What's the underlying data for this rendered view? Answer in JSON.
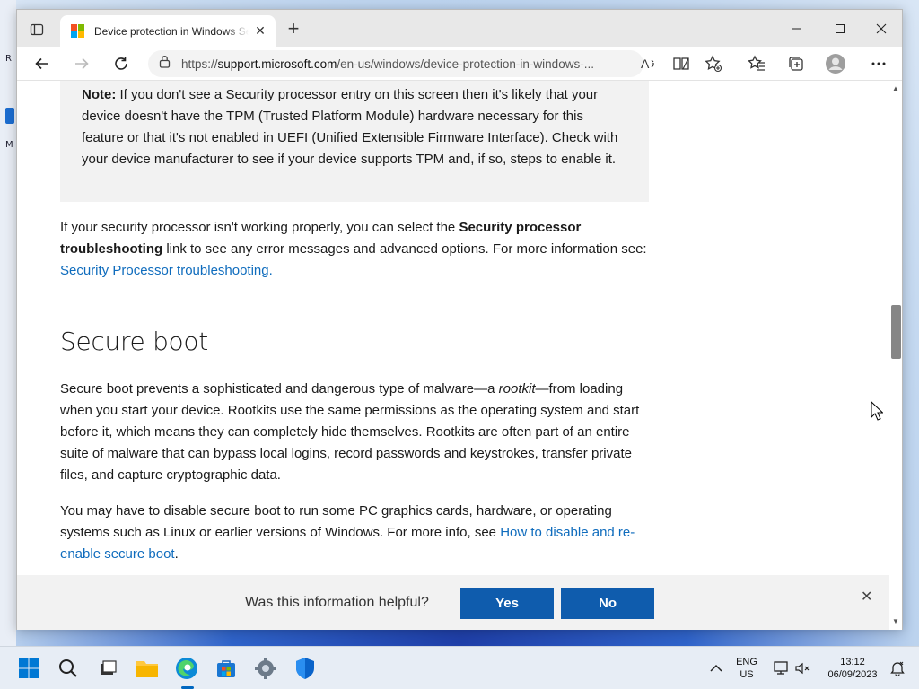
{
  "browser": {
    "tab_title": "Device protection in Windows Se",
    "new_tab_glyph": "+",
    "tab_close_glyph": "✕",
    "url_prefix": "https://",
    "url_host": "support.microsoft.com",
    "url_path": "/en-us/windows/device-protection-in-windows-...",
    "window_controls": {
      "minimize": "—",
      "maximize": "☐",
      "close": "✕"
    }
  },
  "content": {
    "note_label": "Note:",
    "note_text": " If you don't see a Security processor entry on this screen then it's likely that your device doesn't have the TPM (Trusted Platform Module) hardware necessary for this feature or that it's not enabled in UEFI (Unified Extensible Firmware Interface). Check with your device manufacturer to see if your device supports TPM and, if so, steps to enable it.",
    "troubleshoot_part1": "If your security processor isn't working properly, you can select the ",
    "troubleshoot_bold": "Security processor troubleshooting",
    "troubleshoot_part2": " link to see any error messages and advanced options. For more information see: ",
    "troubleshoot_link": "Security Processor troubleshooting.",
    "heading": "Secure boot",
    "secure_boot_part1": "Secure boot prevents a sophisticated and dangerous type of malware—a ",
    "secure_boot_italic": "rootkit",
    "secure_boot_part2": "—from loading when you start your device. Rootkits use the same permissions as the operating system and start before it, which means they can completely hide themselves. Rootkits are often part of an entire suite of malware that can bypass local logins, record passwords and keystrokes, transfer private files, and capture cryptographic data.",
    "disable_part1": "You may have to disable secure boot to run some PC graphics cards, hardware, or operating systems such as Linux or earlier versions of Windows. For more info, see ",
    "disable_link": "How to disable and re-enable secure boot",
    "disable_part2": "."
  },
  "feedback": {
    "question": "Was this information helpful?",
    "yes": "Yes",
    "no": "No",
    "close_glyph": "✕"
  },
  "taskbar": {
    "lang_line1": "ENG",
    "lang_line2": "US",
    "time": "13:12",
    "date": "06/09/2023"
  },
  "colors": {
    "accent": "#0f5cad",
    "link": "#0f6cbd",
    "note_bg": "#f2f2f2"
  }
}
